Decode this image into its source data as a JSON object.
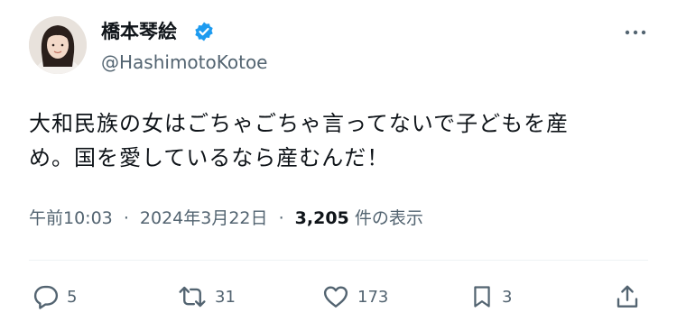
{
  "user": {
    "display_name": "橋本琴絵",
    "handle": "@HashimotoKotoe",
    "verified_icon": "verified-badge-icon",
    "accent_color": "#1d9bf0"
  },
  "tweet": {
    "text": "大和民族の女はごちゃごちゃ言ってないで子どもを産\nめ。国を愛しているなら産むんだ！",
    "time": "午前10:03",
    "separator": "·",
    "date": "2024年3月22日",
    "views_count": "3,205",
    "views_label": "件の表示"
  },
  "actions": {
    "reply_count": "5",
    "retweet_count": "31",
    "like_count": "173",
    "bookmark_count": "3",
    "icons": [
      "reply-icon",
      "retweet-icon",
      "like-icon",
      "bookmark-icon",
      "share-icon"
    ]
  },
  "header": {
    "more_icon": "more-options-icon"
  }
}
